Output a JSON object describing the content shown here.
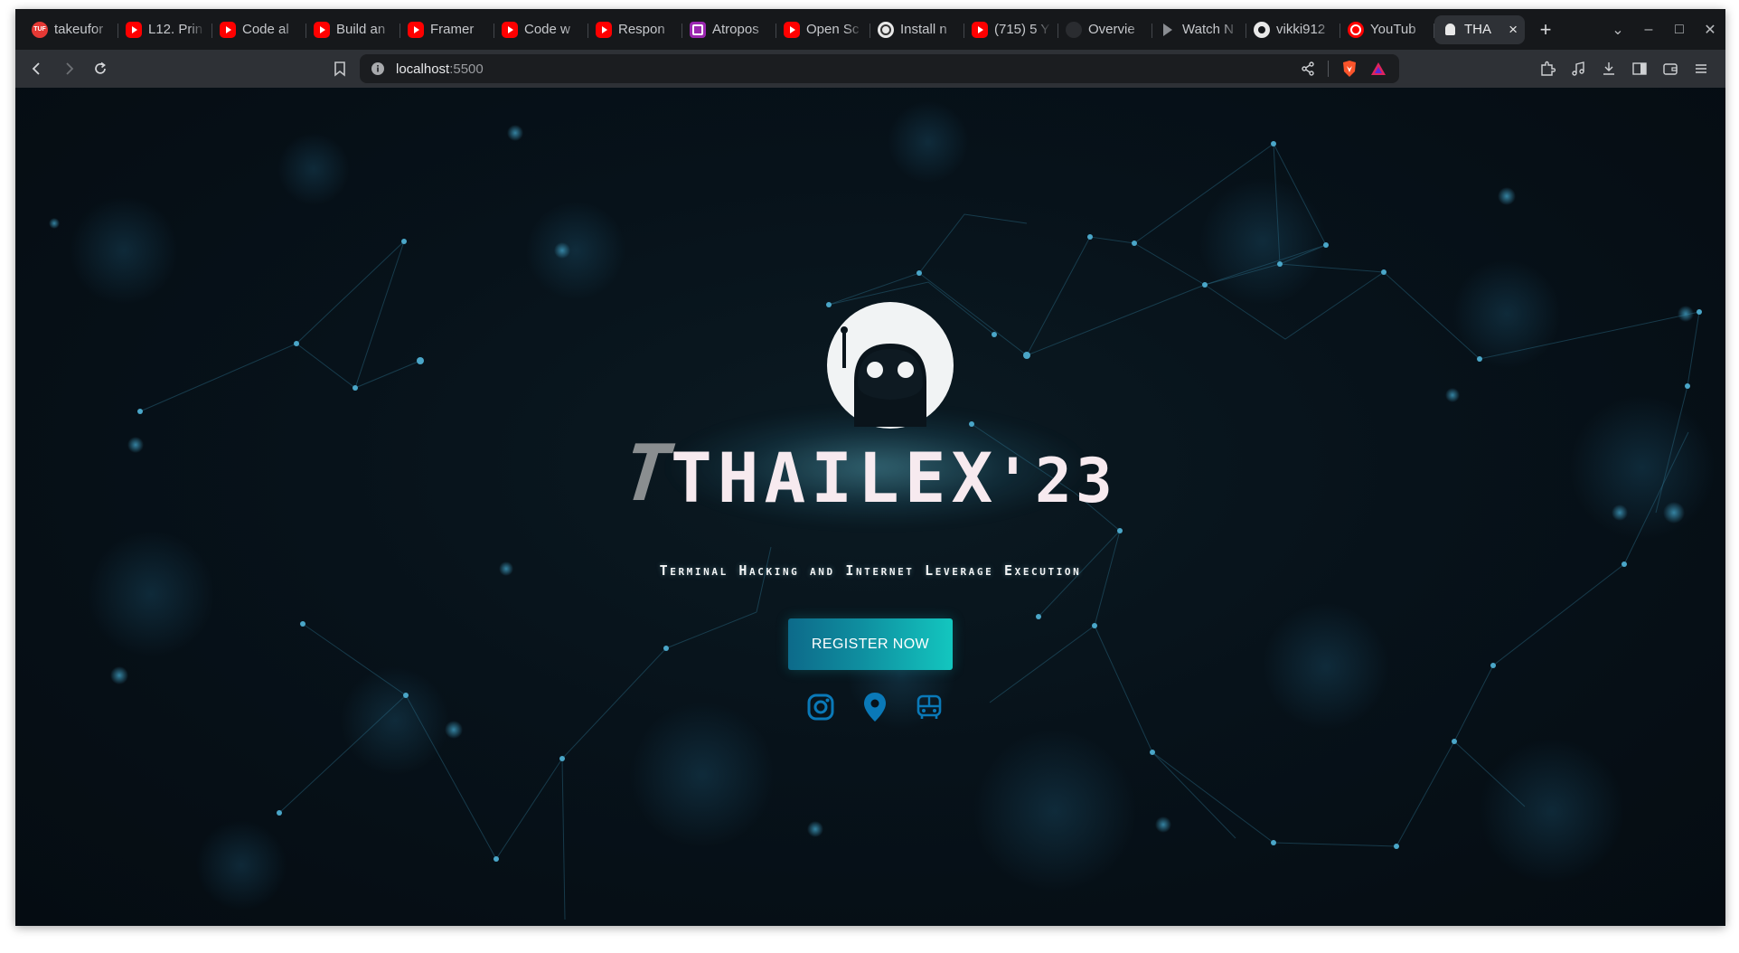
{
  "browser": {
    "tabs": [
      {
        "label": "takeufor",
        "icon": "takeuforward-favicon-icon",
        "fav": "tuf"
      },
      {
        "label": "L12. Prin",
        "icon": "youtube-favicon-icon",
        "fav": "yt"
      },
      {
        "label": "Code al",
        "icon": "youtube-favicon-icon",
        "fav": "yt"
      },
      {
        "label": "Build an",
        "icon": "youtube-favicon-icon",
        "fav": "yt"
      },
      {
        "label": "Framer",
        "icon": "youtube-favicon-icon",
        "fav": "yt"
      },
      {
        "label": "Code w",
        "icon": "youtube-favicon-icon",
        "fav": "yt"
      },
      {
        "label": "Respon",
        "icon": "youtube-favicon-icon",
        "fav": "yt"
      },
      {
        "label": "Atropos",
        "icon": "atropos-favicon-icon",
        "fav": "atr"
      },
      {
        "label": "Open Sc",
        "icon": "youtube-favicon-icon",
        "fav": "yt"
      },
      {
        "label": "Install n",
        "icon": "openai-favicon-icon",
        "fav": "oai"
      },
      {
        "label": "(715) 5 Y",
        "icon": "youtube-favicon-icon",
        "fav": "yt"
      },
      {
        "label": "Overvie",
        "icon": "overview-favicon-icon",
        "fav": "ovw"
      },
      {
        "label": "Watch N",
        "icon": "play-favicon-icon",
        "fav": "play"
      },
      {
        "label": "vikki912",
        "icon": "github-favicon-icon",
        "fav": "gh"
      },
      {
        "label": "YouTub",
        "icon": "youtube-music-favicon-icon",
        "fav": "ytm"
      }
    ],
    "active_tab": {
      "label": "THA",
      "icon": "thailex-favicon-icon"
    },
    "url": {
      "host": "localhost",
      "port": ":5500"
    }
  },
  "page": {
    "brand": {
      "title_main": "THAILEX",
      "title_suffix": "'23",
      "tagline": "Terminal Hacking and Internet Leverage Execution"
    },
    "register_label": "REGISTER NOW",
    "social": [
      "instagram-icon",
      "location-pin-icon",
      "bus-icon"
    ]
  },
  "colors": {
    "accent_teal": "#13c6bf",
    "accent_blue": "#0d6a8a",
    "icon_blue": "#0a79b8"
  }
}
